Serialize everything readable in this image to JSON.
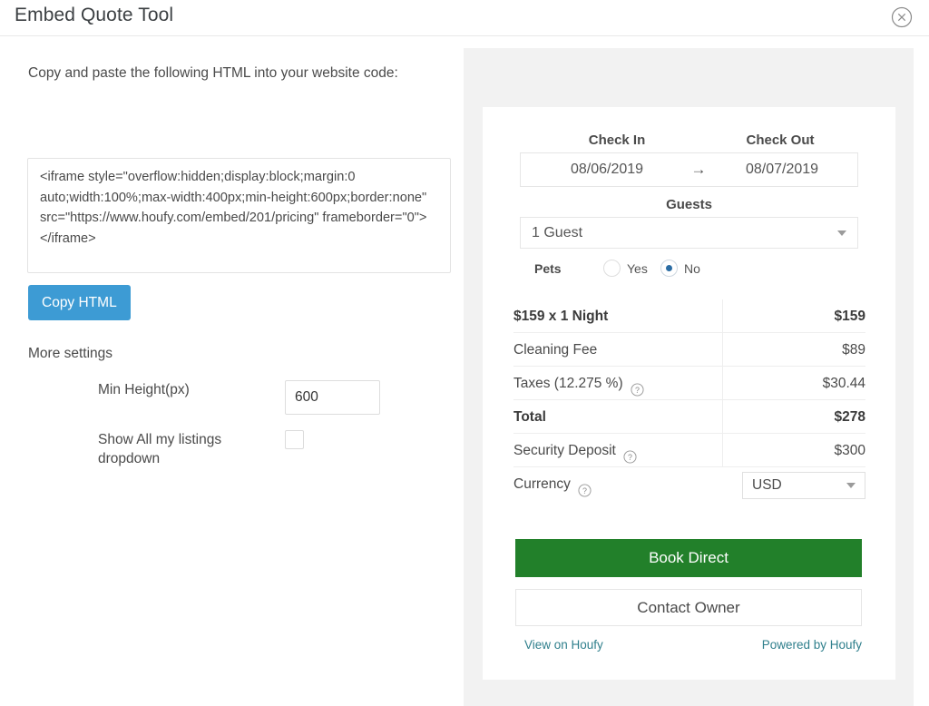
{
  "header": {
    "title": "Embed Quote Tool",
    "close_icon": "close-circle-icon"
  },
  "left": {
    "instructions": "Copy and paste the following HTML into your website code:",
    "embed_code": "<iframe style=\"overflow:hidden;display:block;margin:0 auto;width:100%;max-width:400px;min-height:600px;border:none\" src=\"https://www.houfy.com/embed/201/pricing\" frameborder=\"0\"></iframe>",
    "copy_button": "Copy HTML",
    "more_settings": "More settings",
    "min_height_label": "Min Height(px)",
    "min_height_value": "600",
    "min_height_placeholder": "600",
    "show_dropdown_label": "Show All my listings dropdown",
    "show_dropdown_checked": false
  },
  "widget": {
    "check_in_label": "Check In",
    "check_out_label": "Check Out",
    "check_in_value": "08/06/2019",
    "check_out_value": "08/07/2019",
    "date_arrow": "→",
    "guests_label": "Guests",
    "guests_value": "1 Guest",
    "pets_label": "Pets",
    "pets_yes": "Yes",
    "pets_no": "No",
    "pets_selected": "No",
    "pricing": [
      {
        "label": "$159 x 1 Night",
        "value": "$159",
        "bold": true,
        "help": false
      },
      {
        "label": "Cleaning Fee",
        "value": "$89",
        "bold": false,
        "help": false
      },
      {
        "label": "Taxes (12.275 %)",
        "value": "$30.44",
        "bold": false,
        "help": true
      },
      {
        "label": "Total",
        "value": "$278",
        "bold": true,
        "help": false
      },
      {
        "label": "Security Deposit",
        "value": "$300",
        "bold": false,
        "help": true
      }
    ],
    "currency_label": "Currency",
    "currency_value": "USD",
    "book_button": "Book Direct",
    "contact_button": "Contact Owner",
    "view_link": "View on Houfy",
    "powered_link": "Powered by Houfy",
    "colors": {
      "primary_blue": "#3d9bd4",
      "book_green": "#22802a",
      "link_teal": "#2f7f8c",
      "radio_blue": "#2b6ca3"
    }
  }
}
